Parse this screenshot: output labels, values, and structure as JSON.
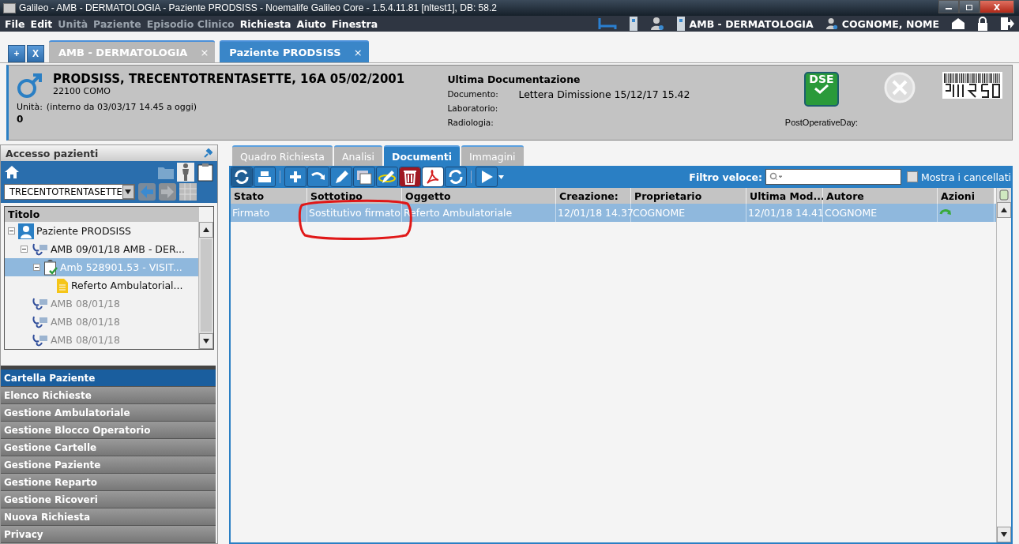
{
  "window": {
    "title": "Galileo - AMB - DERMATOLOGIA - Paziente PRODSISS - Noemalife Galileo Core - 1.5.4.11.81 [nltest1], DB: 58.2"
  },
  "menu": [
    {
      "label": "File",
      "disabled": false
    },
    {
      "label": "Edit",
      "disabled": false
    },
    {
      "label": "Unità",
      "disabled": true
    },
    {
      "label": "Paziente",
      "disabled": true
    },
    {
      "label": "Episodio Clinico",
      "disabled": true
    },
    {
      "label": "Richiesta",
      "disabled": false
    },
    {
      "label": "Aiuto",
      "disabled": false
    },
    {
      "label": "Finestra",
      "disabled": false
    }
  ],
  "status": {
    "unit": "AMB - DERMATOLOGIA",
    "user": "COGNOME, NOME"
  },
  "tab_buttons": [
    "+",
    "X"
  ],
  "doc_tabs": [
    {
      "label": "AMB - DERMATOLOGIA",
      "close": "×",
      "selected": false
    },
    {
      "label": "Paziente PRODSISS",
      "close": "×",
      "selected": true
    }
  ],
  "patient": {
    "name": "PRODSISS, TRECENTOTRENTASETTE, 16A 05/02/2001",
    "city": "22100 COMO",
    "unit_label": "Unità:",
    "unit_value": "(interno da 03/03/17 14.45 a oggi)",
    "count": "0",
    "doc_title": "Ultima Documentazione",
    "doc_rows": [
      {
        "label": "Documento:",
        "value": "Lettera Dimissione 15/12/17 15.42"
      },
      {
        "label": "Laboratorio:",
        "value": ""
      },
      {
        "label": "Radiologia:",
        "value": ""
      }
    ],
    "badge": "DSE",
    "post_op": "PostOperativeDay:"
  },
  "sidebar": {
    "title": "Accesso pazienti",
    "search_value": "TRECENTOTRENTASETTE",
    "tree_header": "Titolo",
    "tree": [
      {
        "label": "Paziente PRODSISS",
        "kind": "patient",
        "expanded": true,
        "selected": false,
        "disabled": false,
        "children": [
          {
            "label": "AMB 09/01/18 AMB - DER...",
            "kind": "visit",
            "expanded": true,
            "selected": false,
            "disabled": false,
            "children": [
              {
                "label": "Amb 528901.53 - VISIT...",
                "kind": "request",
                "expanded": true,
                "selected": true,
                "disabled": false,
                "children": [
                  {
                    "label": "Referto Ambulatorial...",
                    "kind": "document",
                    "selected": false,
                    "disabled": false
                  }
                ]
              }
            ]
          },
          {
            "label": "AMB 08/01/18",
            "kind": "visit",
            "selected": false,
            "disabled": true
          },
          {
            "label": "AMB 08/01/18",
            "kind": "visit",
            "selected": false,
            "disabled": true
          },
          {
            "label": "AMB 08/01/18",
            "kind": "visit",
            "selected": false,
            "disabled": true
          }
        ]
      }
    ],
    "nav": [
      {
        "label": "Cartella Paziente",
        "selected": true
      },
      {
        "label": "Elenco Richieste",
        "selected": false
      },
      {
        "label": "Gestione Ambulatoriale",
        "selected": false
      },
      {
        "label": "Gestione Blocco Operatorio",
        "selected": false
      },
      {
        "label": "Gestione Cartelle",
        "selected": false
      },
      {
        "label": "Gestione Paziente",
        "selected": false
      },
      {
        "label": "Gestione Reparto",
        "selected": false
      },
      {
        "label": "Gestione Ricoveri",
        "selected": false
      },
      {
        "label": "Nuova Richiesta",
        "selected": false
      },
      {
        "label": "Privacy",
        "selected": false
      }
    ]
  },
  "content_tabs": [
    {
      "label": "Quadro Richiesta",
      "selected": false
    },
    {
      "label": "Analisi",
      "selected": false
    },
    {
      "label": "Documenti",
      "selected": true
    },
    {
      "label": "Immagini",
      "selected": false
    }
  ],
  "filter": {
    "label": "Filtro veloce:",
    "show_deleted_label": "Mostra i cancellati",
    "show_deleted": false
  },
  "table": {
    "columns": [
      "Stato",
      "Sottotipo",
      "Oggetto",
      "Creazione:",
      "Proprietario",
      "Ultima Mod...",
      "Autore",
      "Azioni"
    ],
    "rows": [
      {
        "cells": [
          "Firmato",
          "Sostitutivo firmato",
          "Referto Ambulatoriale",
          "12/01/18 14.37",
          "COGNOME",
          "12/01/18 14.41",
          "COGNOME"
        ],
        "selected": true
      }
    ]
  }
}
